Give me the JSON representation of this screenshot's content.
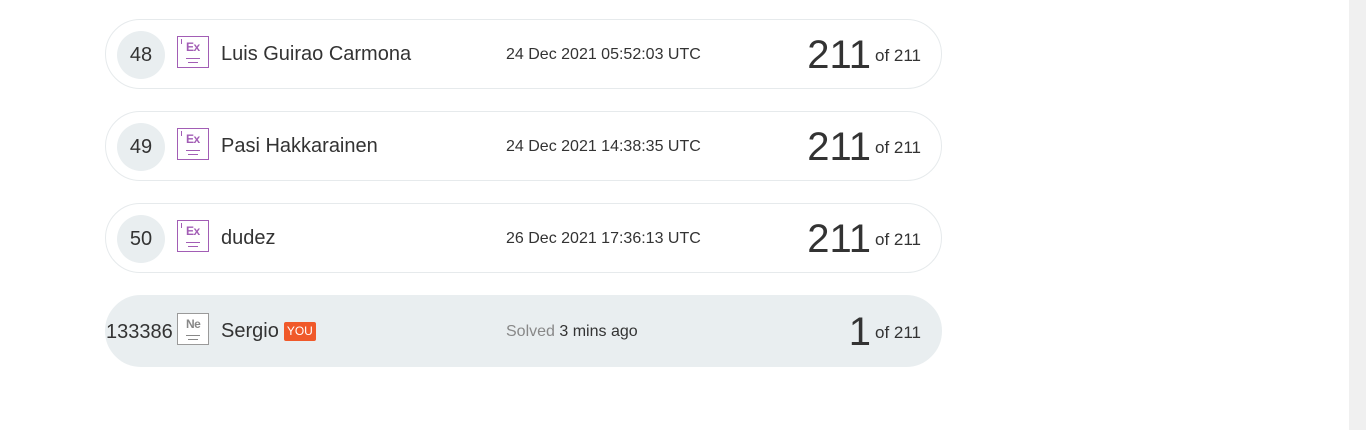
{
  "leaderboard": {
    "rows": [
      {
        "rank": "48",
        "badge": "Ex",
        "name": "Luis Guirao Carmona",
        "date": "24 Dec 2021 05:52:03 UTC",
        "score": "211",
        "of_text": "of 211"
      },
      {
        "rank": "49",
        "badge": "Ex",
        "name": "Pasi Hakkarainen",
        "date": "24 Dec 2021 14:38:35 UTC",
        "score": "211",
        "of_text": "of 211"
      },
      {
        "rank": "50",
        "badge": "Ex",
        "name": "dudez",
        "date": "26 Dec 2021 17:36:13 UTC",
        "score": "211",
        "of_text": "of 211"
      }
    ],
    "current_user": {
      "rank": "133386",
      "badge": "Ne",
      "name": "Sergio",
      "you_label": "YOU",
      "solved_label": "Solved",
      "solved_time": "3 mins ago",
      "score": "1",
      "of_text": "of 211"
    }
  },
  "colors": {
    "expert_badge": "#a25db5",
    "newbie_badge": "#888888",
    "you_badge": "#f0592a",
    "current_row_bg": "#e9eef0"
  }
}
